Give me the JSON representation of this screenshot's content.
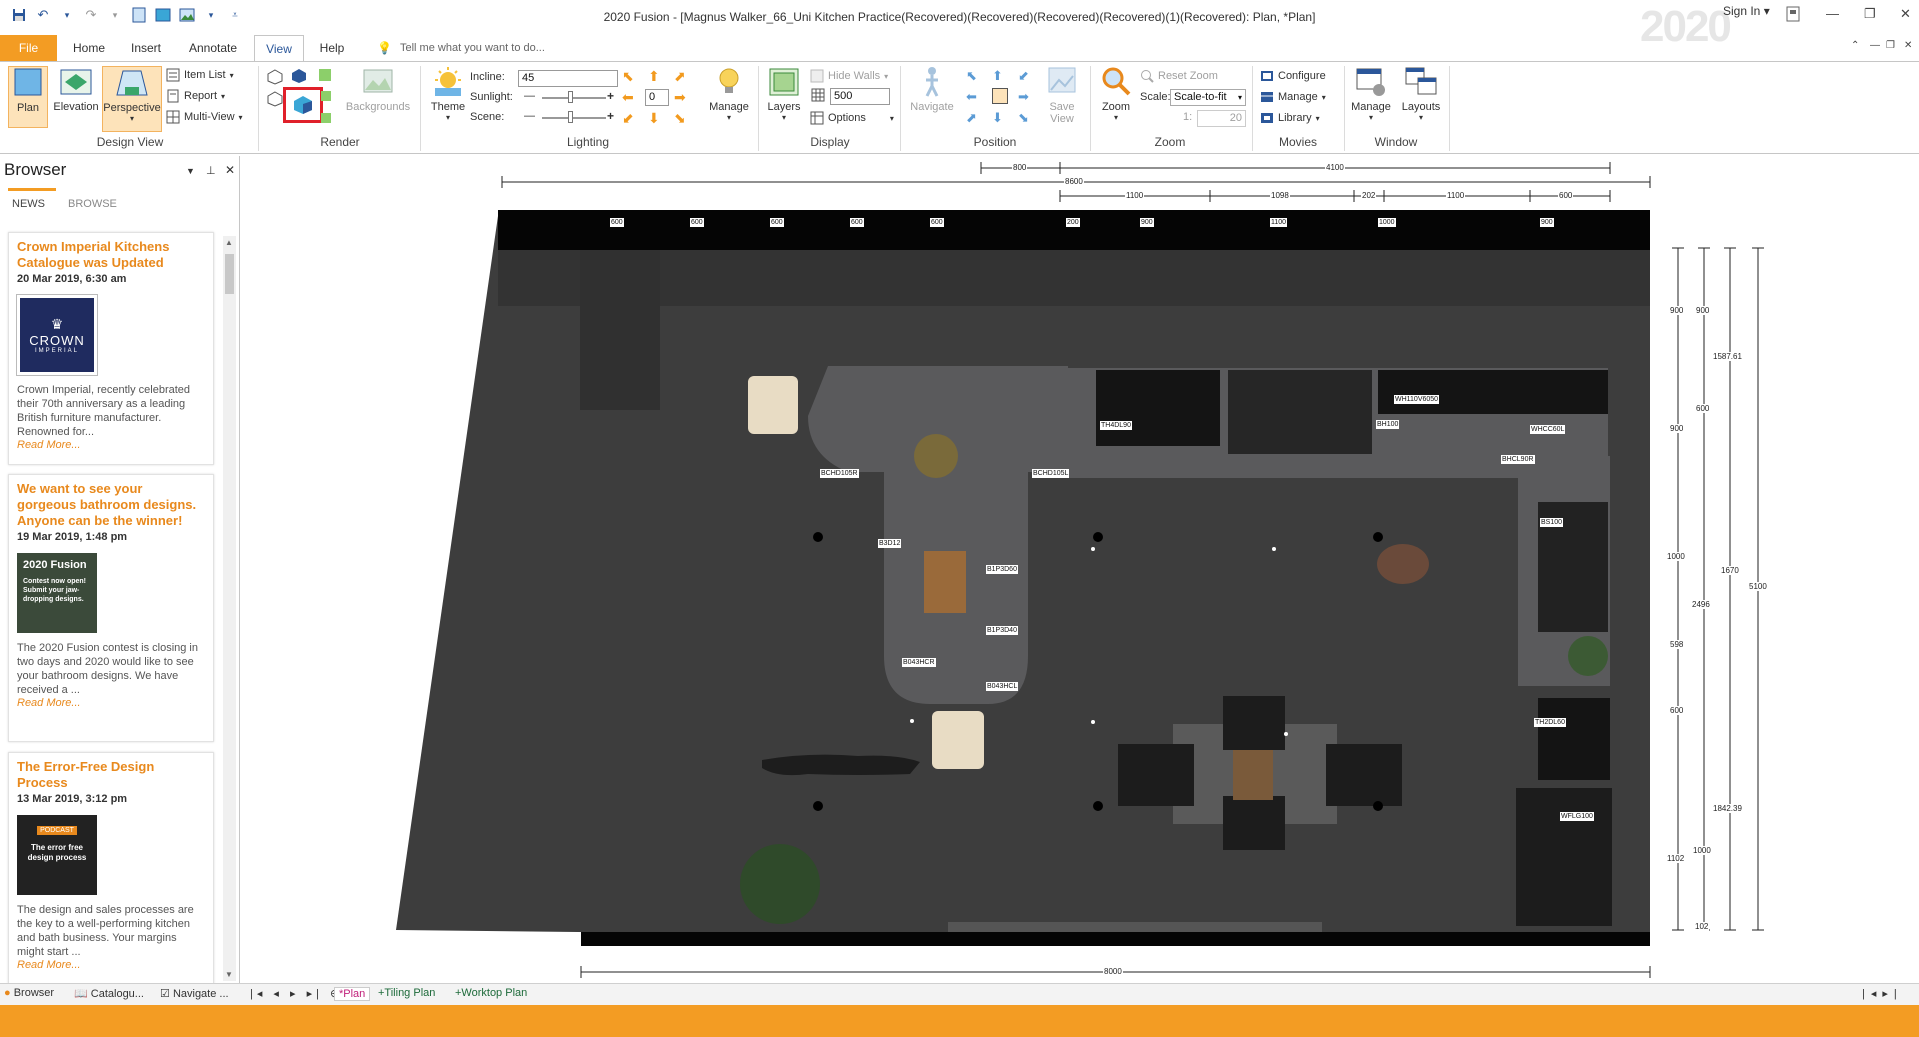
{
  "window": {
    "title": "2020 Fusion - [Magnus Walker_66_Uni Kitchen Practice(Recovered)(Recovered)(Recovered)(Recovered)(1)(Recovered): Plan, *Plan]",
    "brand_logo_text": "2020",
    "sign_in": "Sign In"
  },
  "tabs": [
    "File",
    "Home",
    "Insert",
    "Annotate",
    "View",
    "Help"
  ],
  "active_tab": "View",
  "tell_me": "Tell me what you want to do...",
  "ribbon": {
    "design_view": {
      "label": "Design View",
      "plan": "Plan",
      "elevation": "Elevation",
      "perspective": "Perspective",
      "item_list": "Item List",
      "report": "Report",
      "multi_view": "Multi-View"
    },
    "render": {
      "label": "Render",
      "backgrounds": "Backgrounds"
    },
    "lighting": {
      "label": "Lighting",
      "theme": "Theme",
      "incline_label": "Incline:",
      "incline_value": "45",
      "sunlight_label": "Sunlight:",
      "sunlight_value": "0",
      "scene_label": "Scene:",
      "manage": "Manage"
    },
    "display": {
      "label": "Display",
      "layers": "Layers",
      "hide_walls": "Hide Walls",
      "value": "500",
      "options": "Options"
    },
    "position": {
      "label": "Position",
      "navigate": "Navigate",
      "save_view": "Save View"
    },
    "zoom": {
      "label": "Zoom",
      "zoom": "Zoom",
      "reset_zoom": "Reset Zoom",
      "scale_label": "Scale:",
      "scale_value": "Scale-to-fit",
      "ratio_label": "1:",
      "ratio_value": "20"
    },
    "movies": {
      "label": "Movies",
      "configure": "Configure",
      "manage": "Manage",
      "library": "Library"
    },
    "window": {
      "label": "Window",
      "manage": "Manage",
      "layouts": "Layouts"
    }
  },
  "browser": {
    "title": "Browser",
    "tab_news": "NEWS",
    "tab_browse": "BROWSE",
    "articles": [
      {
        "title": "Crown Imperial Kitchens Catalogue was Updated",
        "date": "20 Mar 2019, 6:30 am",
        "thumb_text_1": "CROWN",
        "thumb_text_2": "IMPERIAL",
        "body": "Crown Imperial, recently celebrated their 70th anniversary as a leading British furniture manufacturer. Renowned for...",
        "read_more": "Read More..."
      },
      {
        "title": "We want to see your gorgeous bathroom designs. Anyone can be the winner!",
        "date": "19 Mar 2019, 1:48 pm",
        "thumb_text_1": "2020 Fusion",
        "thumb_text_2": "Contest now open! Submit your jaw-dropping designs.",
        "body": "The 2020 Fusion contest is closing in two days and 2020 would like to see your bathroom designs. We have received a ...",
        "read_more": "Read More..."
      },
      {
        "title": "The Error-Free Design Process",
        "date": "13 Mar 2019, 3:12 pm",
        "thumb_text_1": "PODCAST",
        "thumb_text_2": "The error free design process",
        "body": "The design and sales processes are the key to a well-performing kitchen and bath business. Your margins might start ...",
        "read_more": "Read More..."
      }
    ]
  },
  "bottom_tabs": {
    "panel_tabs": [
      "Browser",
      "Catalogu...",
      "Navigate ..."
    ],
    "view_tabs": [
      "*Plan",
      "+Tiling Plan",
      "+Worktop Plan"
    ]
  },
  "plan": {
    "top_dims": [
      "800",
      "4100",
      "8600",
      "1100",
      "1098",
      "202",
      "1100",
      "600"
    ],
    "wall_labels": [
      "600",
      "600",
      "600",
      "600",
      "600",
      "200",
      "900",
      "1100",
      "1000",
      "900"
    ],
    "unit_labels": [
      "TH4DL90",
      "WH110V6050",
      "BH100",
      "WHCC60L",
      "BHCL90R",
      "BCHD105R",
      "BCHD105L",
      "B3D12",
      "B1P3D60",
      "B1P3D40",
      "B043HCR",
      "B043HCL",
      "BS100",
      "TH2DL60",
      "WFLG100"
    ],
    "right_dims": [
      "900",
      "900",
      "1587.61",
      "600",
      "900",
      "1000",
      "1670",
      "5100",
      "2496",
      "598",
      "600",
      "1842.39",
      "1102",
      "1000",
      "102"
    ],
    "bottom_dim": "8000"
  },
  "colors": {
    "accent": "#f39c23",
    "link": "#e8891d",
    "ribbon_blue": "#2b579a"
  }
}
